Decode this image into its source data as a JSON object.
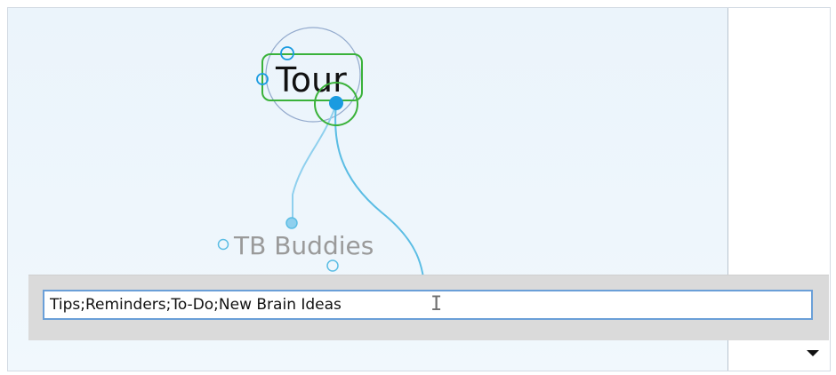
{
  "mindmap": {
    "active_thought": {
      "label": "Tour"
    },
    "child_thought": {
      "label": "TB Buddies"
    }
  },
  "new_thought_input": {
    "value": "Tips;Reminders;To-Do;New Brain Ideas",
    "caret_icon": "text-cursor-icon"
  },
  "side_panel": {
    "dropdown_icon": "triangle-down-icon"
  },
  "colors": {
    "canvas_bg": "#eef6fc",
    "link_line": "#5bbde4",
    "selection_green": "#3ab23a",
    "gate_blue": "#1a9be0",
    "halo": "#8aa2c8",
    "child_label": "#9a9a9a"
  }
}
